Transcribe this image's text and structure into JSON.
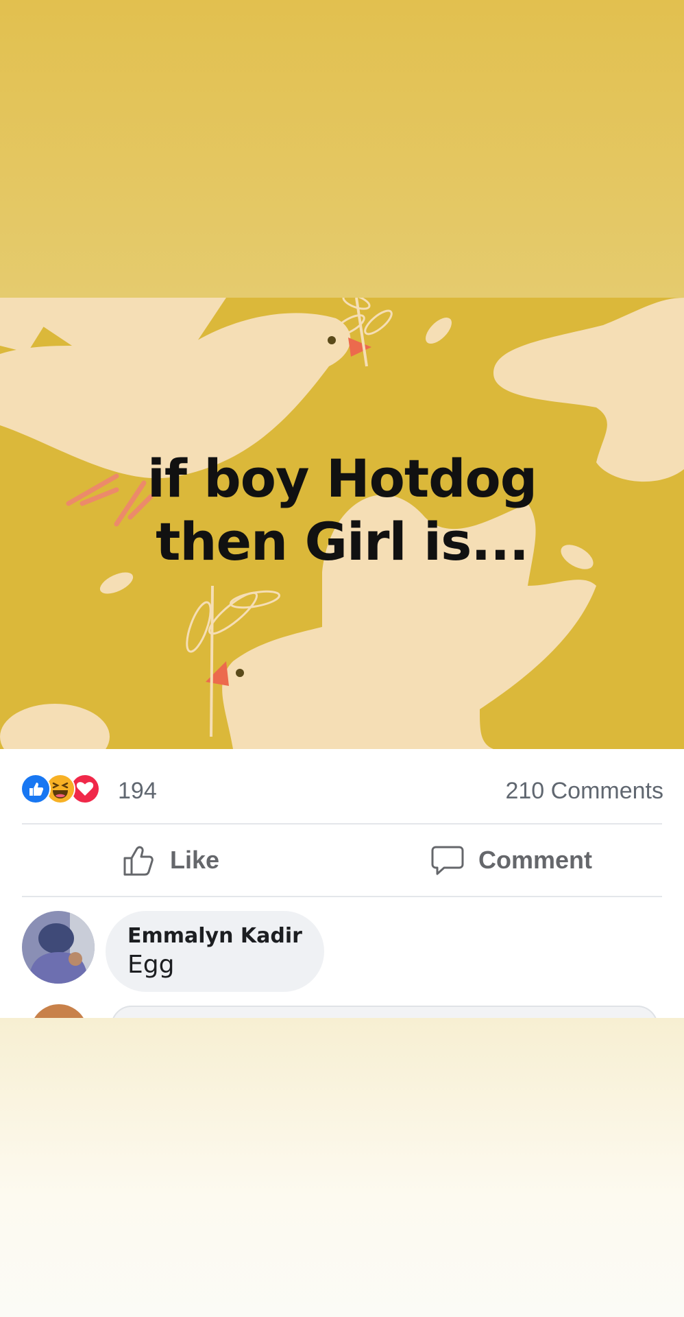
{
  "post": {
    "text_line1": "if boy Hotdog",
    "text_line2": "then Girl is...",
    "image_background_color": "#dbb83a"
  },
  "reactions": {
    "icons": [
      "like-icon",
      "haha-icon",
      "love-icon"
    ],
    "count": "194",
    "comments": "210 Comments"
  },
  "actions": {
    "like_label": "Like",
    "comment_label": "Comment"
  },
  "comment": {
    "author": "Emmalyn Kadir",
    "text": "Egg"
  },
  "colors": {
    "like_blue": "#1877f2",
    "love_red": "#f02849",
    "haha_yellow": "#f7b125",
    "muted_text": "#65676b"
  }
}
